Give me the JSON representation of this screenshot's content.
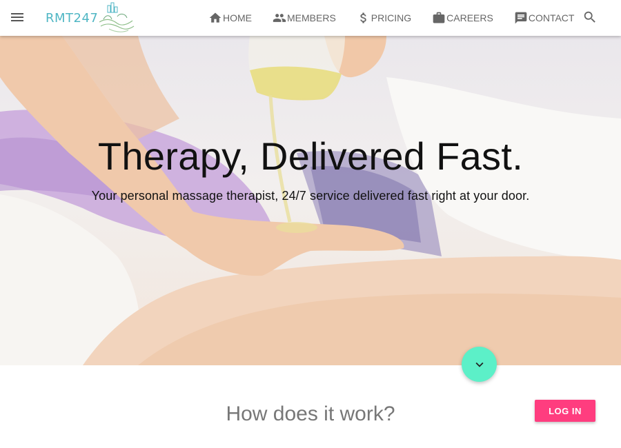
{
  "brand": {
    "logo_text": "RMT247"
  },
  "nav": {
    "items": [
      {
        "label": "HOME",
        "icon": "home-icon"
      },
      {
        "label": "MEMBERS",
        "icon": "people-icon"
      },
      {
        "label": "PRICING",
        "icon": "dollar-icon"
      },
      {
        "label": "CAREERS",
        "icon": "briefcase-icon"
      },
      {
        "label": "CONTACT",
        "icon": "chat-icon"
      }
    ]
  },
  "hero": {
    "title": "Therapy, Delivered Fast.",
    "subtitle": "Your personal massage therapist, 24/7 service delivered fast right at your door."
  },
  "section": {
    "title": "How does it work?"
  },
  "actions": {
    "login_label": "LOG IN"
  },
  "colors": {
    "accent_teal": "#5cf0c8",
    "login_pink": "#ff3d7f",
    "logo_teal": "#4fb6c4"
  }
}
